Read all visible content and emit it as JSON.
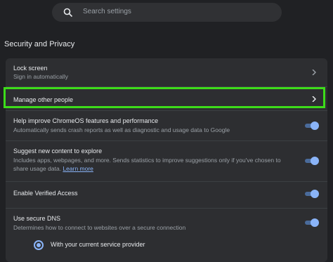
{
  "search": {
    "placeholder": "Search settings",
    "icon": "search-icon"
  },
  "section": {
    "title": "Security and Privacy"
  },
  "rows": {
    "lock_screen": {
      "title": "Lock screen",
      "sub": "Sign in automatically"
    },
    "manage_people": {
      "title": "Manage other people"
    },
    "help_improve": {
      "title": "Help improve ChromeOS features and performance",
      "sub": "Automatically sends crash reports as well as diagnostic and usage data to Google"
    },
    "suggest_content": {
      "title": "Suggest new content to explore",
      "sub_line1": "Includes apps, webpages, and more. Sends statistics to improve suggestions only if you've chosen to",
      "sub_line2": "share usage data.",
      "link": "Learn more"
    },
    "verified_access": {
      "title": "Enable Verified Access"
    },
    "secure_dns": {
      "title": "Use secure DNS",
      "sub": "Determines how to connect to websites over a secure connection"
    },
    "dns_option": {
      "label": "With your current service provider"
    }
  },
  "toggles": {
    "help_improve": true,
    "suggest_content": true,
    "verified_access": true,
    "secure_dns": true
  },
  "colors": {
    "background": "#202124",
    "card": "#2d2e31",
    "accent": "#8ab4f8",
    "highlight": "#3ddc1a"
  }
}
